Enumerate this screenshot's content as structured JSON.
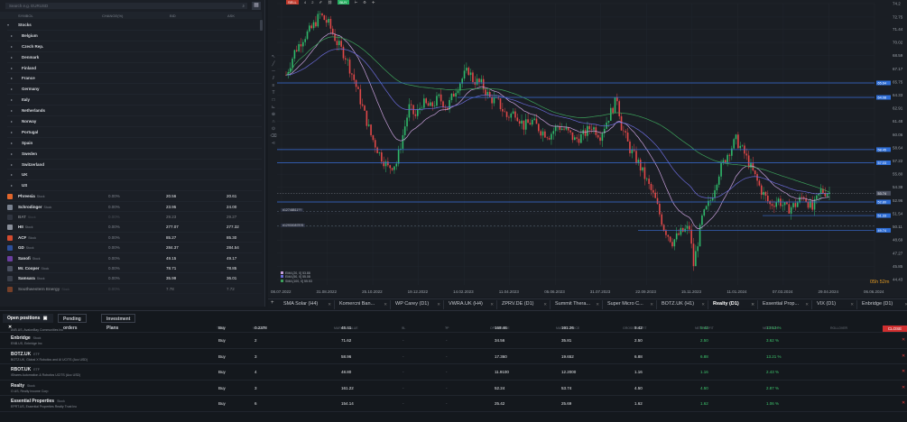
{
  "watchlist": {
    "search_placeholder": "Search e.g. EURUSD",
    "headers": {
      "symbol": "SYMBOL",
      "change": "CHANGE(%)",
      "bid": "BID",
      "ask": "ASK"
    },
    "groups": [
      {
        "label": "Stocks",
        "top": true
      },
      {
        "label": "Belgium"
      },
      {
        "label": "Czech Rep."
      },
      {
        "label": "Denmark"
      },
      {
        "label": "Finland"
      },
      {
        "label": "France"
      },
      {
        "label": "Germany"
      },
      {
        "label": "Italy"
      },
      {
        "label": "Netherlands"
      },
      {
        "label": "Norway"
      },
      {
        "label": "Portugal"
      },
      {
        "label": "Spain"
      },
      {
        "label": "Sweden"
      },
      {
        "label": "Switzerland"
      },
      {
        "label": "UK"
      },
      {
        "label": "US"
      }
    ],
    "stocks": [
      {
        "name": "Phreesia",
        "tag": "Stock",
        "change": "0.00%",
        "bid": "20.56",
        "ask": "20.61",
        "color": "#e2662b"
      },
      {
        "name": "Schrodinger",
        "tag": "Stock",
        "change": "0.00%",
        "bid": "23.95",
        "ask": "24.00",
        "color": "#7a8290"
      },
      {
        "name": "BAT",
        "tag": "Stock",
        "change": "0.00%",
        "bid": "29.23",
        "ask": "29.27",
        "color": "#4a5060",
        "dim": true
      },
      {
        "name": "HII",
        "tag": "Stock",
        "change": "0.00%",
        "bid": "277.07",
        "ask": "277.32",
        "color": "#8a8f9a"
      },
      {
        "name": "ACF",
        "tag": "Stock",
        "change": "0.00%",
        "bid": "85.27",
        "ask": "85.30",
        "color": "#d44b2f"
      },
      {
        "name": "GD",
        "tag": "Stock",
        "change": "0.00%",
        "bid": "284.37",
        "ask": "284.54",
        "color": "#2c4f9c"
      },
      {
        "name": "Sanofi",
        "tag": "Stock",
        "change": "0.00%",
        "bid": "49.15",
        "ask": "49.17",
        "color": "#6b3fa0"
      },
      {
        "name": "Mr. Cooper",
        "tag": "Stock",
        "change": "0.00%",
        "bid": "78.71",
        "ask": "78.85",
        "color": "#4a5060"
      },
      {
        "name": "Samsara",
        "tag": "Stock",
        "change": "0.00%",
        "bid": "35.99",
        "ask": "36.01",
        "color": "#3a3f4a"
      },
      {
        "name": "Southwestern Energy",
        "tag": "Stock",
        "change": "0.00%",
        "bid": "7.78",
        "ask": "7.72",
        "color": "#e2662b",
        "dim": true
      }
    ]
  },
  "chart": {
    "price_labels": [
      "74.2",
      "72.75",
      "71.44",
      "70.02",
      "68.59",
      "67.17",
      "65.75",
      "64.33",
      "62.91",
      "61.48",
      "60.06",
      "58.64",
      "57.22",
      "55.80",
      "54.38",
      "52.96",
      "51.54",
      "50.11",
      "48.69",
      "47.27",
      "45.85",
      "44.43"
    ],
    "tag_labels": [
      "65.64",
      "64.08",
      "58.45",
      "57.03",
      "53.74",
      "52.80",
      "51.33",
      "49.74"
    ],
    "date_labels": [
      "08.07.2022",
      "31.08.2022",
      "25.10.2022",
      "19.12.2022",
      "14.02.2023",
      "11.04.2023",
      "05.06.2023",
      "31.07.2023",
      "22.09.2023",
      "15.11.2023",
      "11.01.2024",
      "07.03.2024",
      "29.04.2024",
      "06.06.2024"
    ],
    "order_labels": [
      "#12748811??",
      "#12930087876"
    ],
    "legend": [
      "EMA [20, 0] 53.88",
      "EMA [50, 0] 55.08",
      "SMA [100, 0] 55.53"
    ],
    "countdown": "05h 52m",
    "top_flags": [
      "4",
      "2"
    ]
  },
  "tabs": {
    "items": [
      {
        "label": "SMA Solar (H4)"
      },
      {
        "label": "Komercni Ban..."
      },
      {
        "label": "WP Carey (D1)"
      },
      {
        "label": "VWRA.UK (H4)"
      },
      {
        "label": "ZPRV.DE (D1)"
      },
      {
        "label": "Summit Thera..."
      },
      {
        "label": "Super Micro C..."
      },
      {
        "label": "BOTZ.UK (H1)"
      },
      {
        "label": "Realty (D1)",
        "active": true
      },
      {
        "label": "Essential Prop..."
      },
      {
        "label": "VIX (D1)"
      },
      {
        "label": "Enbridge (D1)"
      }
    ]
  },
  "positions": {
    "tabs": [
      "Open positions",
      "Pending orders",
      "Investment Plans"
    ],
    "close_label": "CLOSE",
    "headers": {
      "type": "TYPE",
      "volume": "VOLUME",
      "market_value": "MARKET VALUE",
      "sl": "SL",
      "tp": "TP",
      "open_price": "OPEN PRICE",
      "market_price": "MARKET PRICE",
      "gross_profit": "GROSS PROFIT",
      "net_profit": "NET PROFIT",
      "net_pl": "NET P/L %",
      "rollover": "ROLLOVER"
    },
    "rows": [
      {
        "name": "",
        "tag": "",
        "sub": "AVB.US, AvalonBay Communities Inc",
        "type": "Buy",
        "volume": "0.2378",
        "market_value": "45.41",
        "sl": "-",
        "tp": "-",
        "open_price": "168.46",
        "market_price": "191.26",
        "gross_profit": "5.42",
        "net_profit": "5.42",
        "net_pl": "13.53 %",
        "partial": true
      },
      {
        "name": "Enbridge",
        "tag": "Stock",
        "sub": "ENB.US, Enbridge Inc",
        "type": "Buy",
        "volume": "2",
        "market_value": "71.62",
        "sl": "-",
        "tp": "-",
        "open_price": "34.56",
        "market_price": "35.81",
        "gross_profit": "2.50",
        "net_profit": "2.50",
        "net_pl": "3.62 %"
      },
      {
        "name": "BOTZ.UK",
        "tag": "ETF",
        "sub": "BOTZ.UK, Global X Robotics and AI UCITS (Acc USD)",
        "type": "Buy",
        "volume": "3",
        "market_value": "58.96",
        "sl": "-",
        "tp": "-",
        "open_price": "17.360",
        "market_price": "19.652",
        "gross_profit": "6.88",
        "net_profit": "6.88",
        "net_pl": "13.21 %"
      },
      {
        "name": "RBOT.UK",
        "tag": "ETF",
        "sub": "iShares Automation & Robotics UCITS (Acc USD)",
        "type": "Buy",
        "volume": "4",
        "market_value": "48.80",
        "sl": "-",
        "tp": "-",
        "open_price": "11.9100",
        "market_price": "12.2000",
        "gross_profit": "1.16",
        "net_profit": "1.16",
        "net_pl": "2.43 %"
      },
      {
        "name": "Realty",
        "tag": "Stock",
        "sub": "O.US, Realty Income Corp",
        "type": "Buy",
        "volume": "3",
        "market_value": "161.22",
        "sl": "-",
        "tp": "-",
        "open_price": "52.24",
        "market_price": "53.74",
        "gross_profit": "4.50",
        "net_profit": "4.50",
        "net_pl": "2.87 %"
      },
      {
        "name": "Essential Properties",
        "tag": "Stock",
        "sub": "EPRT.US, Essential Properties Realty Trust Inc",
        "type": "Buy",
        "volume": "6",
        "market_value": "154.14",
        "sl": "-",
        "tp": "-",
        "open_price": "25.42",
        "market_price": "25.69",
        "gross_profit": "1.62",
        "net_profit": "1.62",
        "net_pl": "1.06 %"
      }
    ]
  },
  "colors": {
    "up": "#2fb86a",
    "down": "#e04848",
    "hline": "#3a6fd8",
    "ema20": "#c9a0dc",
    "ema50": "#6a6ad8",
    "sma100": "#3ca05a",
    "accent_red": "#d02f2f"
  }
}
